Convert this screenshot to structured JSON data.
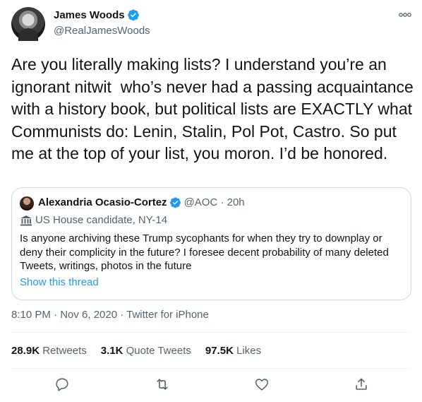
{
  "author": {
    "display_name": "James Woods",
    "handle": "@RealJamesWoods"
  },
  "tweet": {
    "text": "Are you literally making lists? I understand you’re an ignorant nitwit  who’s never had a passing acquaintance with a history book, but political lists are EXACTLY what Communists do: Lenin, Stalin, Pol Pot, Castro. So put me at the top of your list, you moron. I’d be honored.",
    "meta": "8:10 PM · Nov 6, 2020 · Twitter for iPhone"
  },
  "quote": {
    "display_name": "Alexandria Ocasio-Cortez",
    "handle_time": "@AOC · 20h",
    "label": "US House candidate, NY-14",
    "text": "Is anyone archiving these Trump sycophants for when they try to downplay or deny their complicity in the future? I foresee decent probability of many deleted Tweets, writings, photos in the future",
    "thread_link": "Show this thread"
  },
  "stats": {
    "retweets_count": "28.9K",
    "retweets_label": "Retweets",
    "quotes_count": "3.1K",
    "quotes_label": "Quote Tweets",
    "likes_count": "97.5K",
    "likes_label": "Likes"
  },
  "icons": {
    "verified": "verified-badge-icon",
    "more": "more-icon",
    "government": "government-building-icon",
    "reply": "reply-icon",
    "retweet": "retweet-icon",
    "like": "heart-icon",
    "share": "share-icon"
  },
  "colors": {
    "accent": "#1d9bf0",
    "secondary_text": "#536471",
    "border": "#cfd9de"
  }
}
